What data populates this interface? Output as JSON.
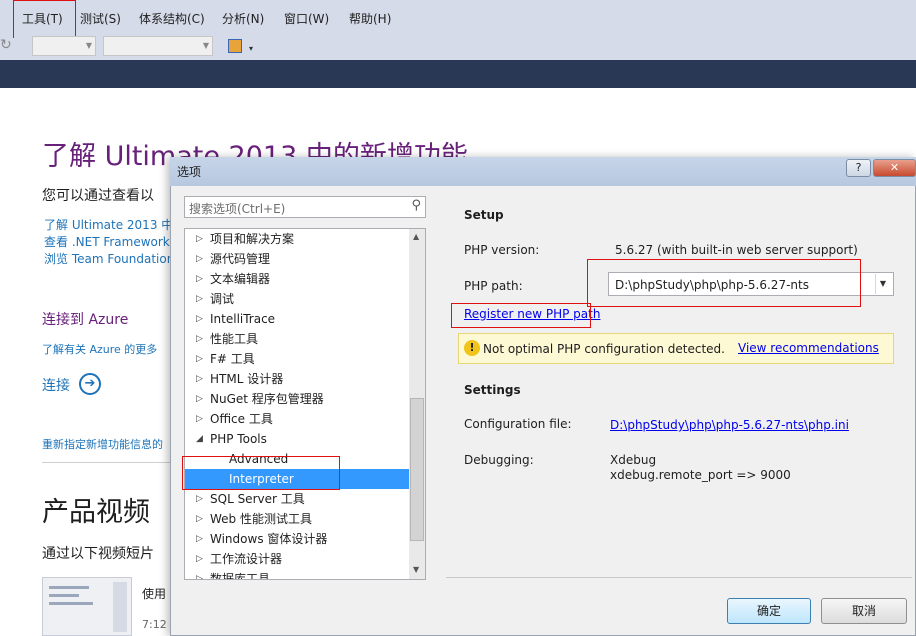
{
  "menu": {
    "items": [
      "工具(T)",
      "测试(S)",
      "体系结构(C)",
      "分析(N)",
      "窗口(W)",
      "帮助(H)"
    ]
  },
  "start_page": {
    "heading": "了解 Ultimate 2013 中的新增功能",
    "intro": "您可以通过查看以",
    "links": [
      "了解 Ultimate 2013 中",
      "查看 .NET Framework",
      "浏览 Team Foundation"
    ],
    "azure_title": "连接到 Azure",
    "azure_link": "了解有关 Azure 的更多",
    "connect": "连接",
    "retarget": "重新指定新增功能信息的",
    "video_title": "产品视频",
    "video_intro": "通过以下视频短片",
    "video_caption": "使用",
    "video_time": "7:12"
  },
  "dialog": {
    "title": "选项",
    "help": "?",
    "search_placeholder": "搜索选项(Ctrl+E)",
    "tree": [
      {
        "label": "项目和解决方案",
        "caret": "▷"
      },
      {
        "label": "源代码管理",
        "caret": "▷"
      },
      {
        "label": "文本编辑器",
        "caret": "▷"
      },
      {
        "label": "调试",
        "caret": "▷"
      },
      {
        "label": "IntelliTrace",
        "caret": "▷"
      },
      {
        "label": "性能工具",
        "caret": "▷"
      },
      {
        "label": "F# 工具",
        "caret": "▷"
      },
      {
        "label": "HTML 设计器",
        "caret": "▷"
      },
      {
        "label": "NuGet 程序包管理器",
        "caret": "▷"
      },
      {
        "label": "Office 工具",
        "caret": "▷"
      },
      {
        "label": "PHP Tools",
        "caret": "◢"
      },
      {
        "label": "Advanced",
        "caret": ""
      },
      {
        "label": "Interpreter",
        "caret": ""
      },
      {
        "label": "SQL Server 工具",
        "caret": "▷"
      },
      {
        "label": "Web 性能测试工具",
        "caret": "▷"
      },
      {
        "label": "Windows 窗体设计器",
        "caret": "▷"
      },
      {
        "label": "工作流设计器",
        "caret": "▷"
      },
      {
        "label": "数据库工具",
        "caret": "▷"
      }
    ],
    "setup": {
      "heading": "Setup",
      "version_label": "PHP version:",
      "version_value": "5.6.27 (with built-in web server support)",
      "path_label": "PHP path:",
      "path_value": "D:\\phpStudy\\php\\php-5.6.27-nts",
      "register_link": "Register new PHP path",
      "warning_text": "Not optimal PHP configuration detected.",
      "warning_link": "View recommendations"
    },
    "settings": {
      "heading": "Settings",
      "config_label": "Configuration file:",
      "config_value": "D:\\phpStudy\\php\\php-5.6.27-nts\\php.ini",
      "debug_label": "Debugging:",
      "debug_value": "Xdebug",
      "debug_port": "xdebug.remote_port => 9000"
    },
    "ok": "确定",
    "cancel": "取消"
  },
  "colors": {
    "accent_purple": "#68217a",
    "highlight_red": "#e01010",
    "selection": "#3399ff"
  }
}
